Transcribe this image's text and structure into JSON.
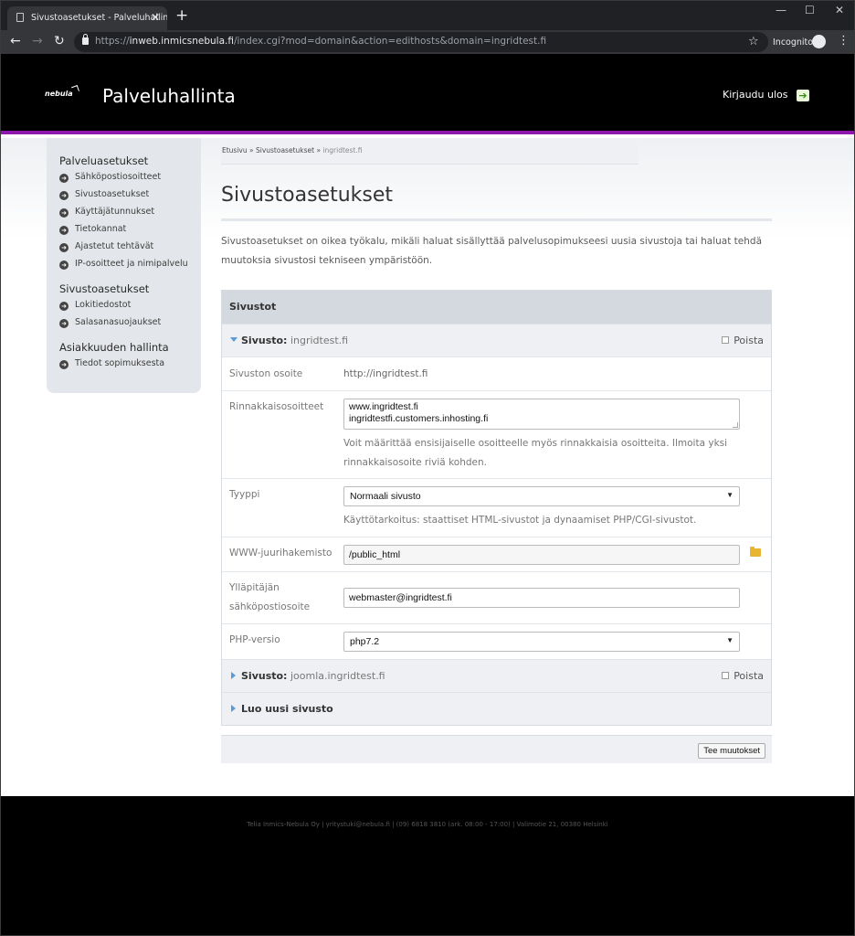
{
  "browser": {
    "tab_title": "Sivustoasetukset - Palveluhallinta",
    "url_scheme": "https://",
    "url_host": "inweb.inmicsnebula.fi",
    "url_path": "/index.cgi?mod=domain&action=edithosts&domain=ingridtest.fi",
    "incognito_label": "Incognito"
  },
  "header": {
    "logo_text": "nebula",
    "site_title": "Palveluhallinta",
    "logout_label": "Kirjaudu ulos"
  },
  "sidebar": {
    "groups": [
      {
        "title": "Palveluasetukset",
        "items": [
          "Sähköpostiosoitteet",
          "Sivustoasetukset",
          "Käyttäjätunnukset",
          "Tietokannat",
          "Ajastetut tehtävät",
          "IP-osoitteet ja nimipalvelu"
        ]
      },
      {
        "title": "Sivustoasetukset",
        "items": [
          "Lokitiedostot",
          "Salasanasuojaukset"
        ]
      },
      {
        "title": "Asiakkuuden hallinta",
        "items": [
          "Tiedot sopimuksesta"
        ]
      }
    ]
  },
  "breadcrumb": {
    "home": "Etusivu",
    "sep": " » ",
    "section": "Sivustoasetukset",
    "current": "ingridtest.fi"
  },
  "main": {
    "title": "Sivustoasetukset",
    "intro": "Sivustoasetukset on oikea työkalu, mikäli haluat sisällyttää palvelusopimukseesi uusia sivustoja tai haluat tehdä muutoksia sivustosi tekniseen ympäristöön.",
    "panel_title": "Sivustot",
    "site_label": "Sivusto:",
    "delete_label": "Poista",
    "site1": {
      "name": "ingridtest.fi",
      "address_label": "Sivuston osoite",
      "address_value": "http://ingridtest.fi",
      "aliases_label": "Rinnakkaisosoitteet",
      "aliases_line1": "www.ingridtest.fi",
      "aliases_line2": "ingridtestfi.customers.inhosting.fi",
      "aliases_hint": "Voit määrittää ensisijaiselle osoitteelle myös rinnakkaisia osoitteita. Ilmoita yksi rinnakkaisosoite riviä kohden.",
      "type_label": "Tyyppi",
      "type_value": "Normaali sivusto",
      "type_hint": "Käyttötarkoitus: staattiset HTML-sivustot ja dynaamiset PHP/CGI-sivustot.",
      "root_label": "WWW-juurihakemisto",
      "root_value": "/public_html",
      "admin_email_label": "Ylläpitäjän sähköpostiosoite",
      "admin_email_value": "webmaster@ingridtest.fi",
      "php_label": "PHP-versio",
      "php_value": "php7.2"
    },
    "site2_name": "joomla.ingridtest.fi",
    "new_site_label": "Luo uusi sivusto",
    "save_button": "Tee muutokset"
  },
  "footer": {
    "text": "Telia Inmics-Nebula Oy   |   yritystuki@nebula.fi   |   (09) 6818 3810 (ark. 08:00 - 17:00)   |   Valimotie 21, 00380 Helsinki"
  }
}
